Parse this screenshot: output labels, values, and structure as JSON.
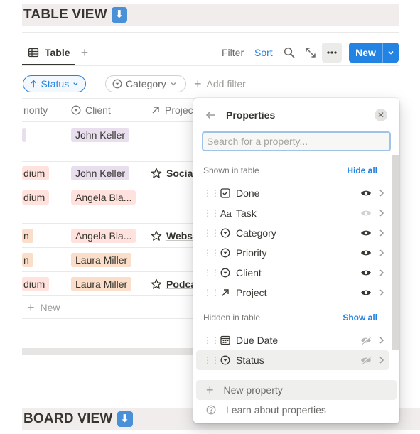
{
  "sections": {
    "table_view": "TABLE VIEW",
    "board_view": "BOARD VIEW",
    "arrow_emoji": "⬇"
  },
  "toolbar": {
    "tab_label": "Table",
    "filter_label": "Filter",
    "sort_label": "Sort",
    "new_label": "New",
    "accent": "#2383e2"
  },
  "filters": {
    "status_label": "Status",
    "category_label": "Category",
    "add_filter_label": "Add filter"
  },
  "table": {
    "columns": [
      "riority",
      "Client",
      "Projec"
    ],
    "rows": [
      {
        "priority": "",
        "client": "John Keller",
        "project": ""
      },
      {
        "priority": "dium",
        "client": "John Keller",
        "project": "Socia"
      },
      {
        "priority": "dium",
        "client": "Angela Bla...",
        "project": ""
      },
      {
        "priority": "n",
        "client": "Angela Bla...",
        "project": "Webs"
      },
      {
        "priority": "n",
        "client": "Laura Miller",
        "project": ""
      },
      {
        "priority": "dium",
        "client": "Laura Miller",
        "project": "Podca"
      }
    ],
    "new_row_label": "New"
  },
  "properties_panel": {
    "title": "Properties",
    "search_placeholder": "Search for a property...",
    "shown_label": "Shown in table",
    "hide_all_label": "Hide all",
    "hidden_label": "Hidden in table",
    "show_all_label": "Show all",
    "shown_properties": [
      {
        "name": "Done",
        "type_icon": "checkbox-icon",
        "visible": true
      },
      {
        "name": "Task",
        "type_icon": "text-icon",
        "visible": true
      },
      {
        "name": "Category",
        "type_icon": "select-icon",
        "visible": true
      },
      {
        "name": "Priority",
        "type_icon": "select-icon",
        "visible": true
      },
      {
        "name": "Client",
        "type_icon": "select-icon",
        "visible": true
      },
      {
        "name": "Project",
        "type_icon": "relation-arrow-icon",
        "visible": true
      }
    ],
    "hidden_properties": [
      {
        "name": "Due Date",
        "type_icon": "calendar-icon",
        "visible": false
      },
      {
        "name": "Status",
        "type_icon": "select-icon",
        "visible": false
      }
    ],
    "new_property_label": "New property",
    "learn_label": "Learn about properties"
  }
}
